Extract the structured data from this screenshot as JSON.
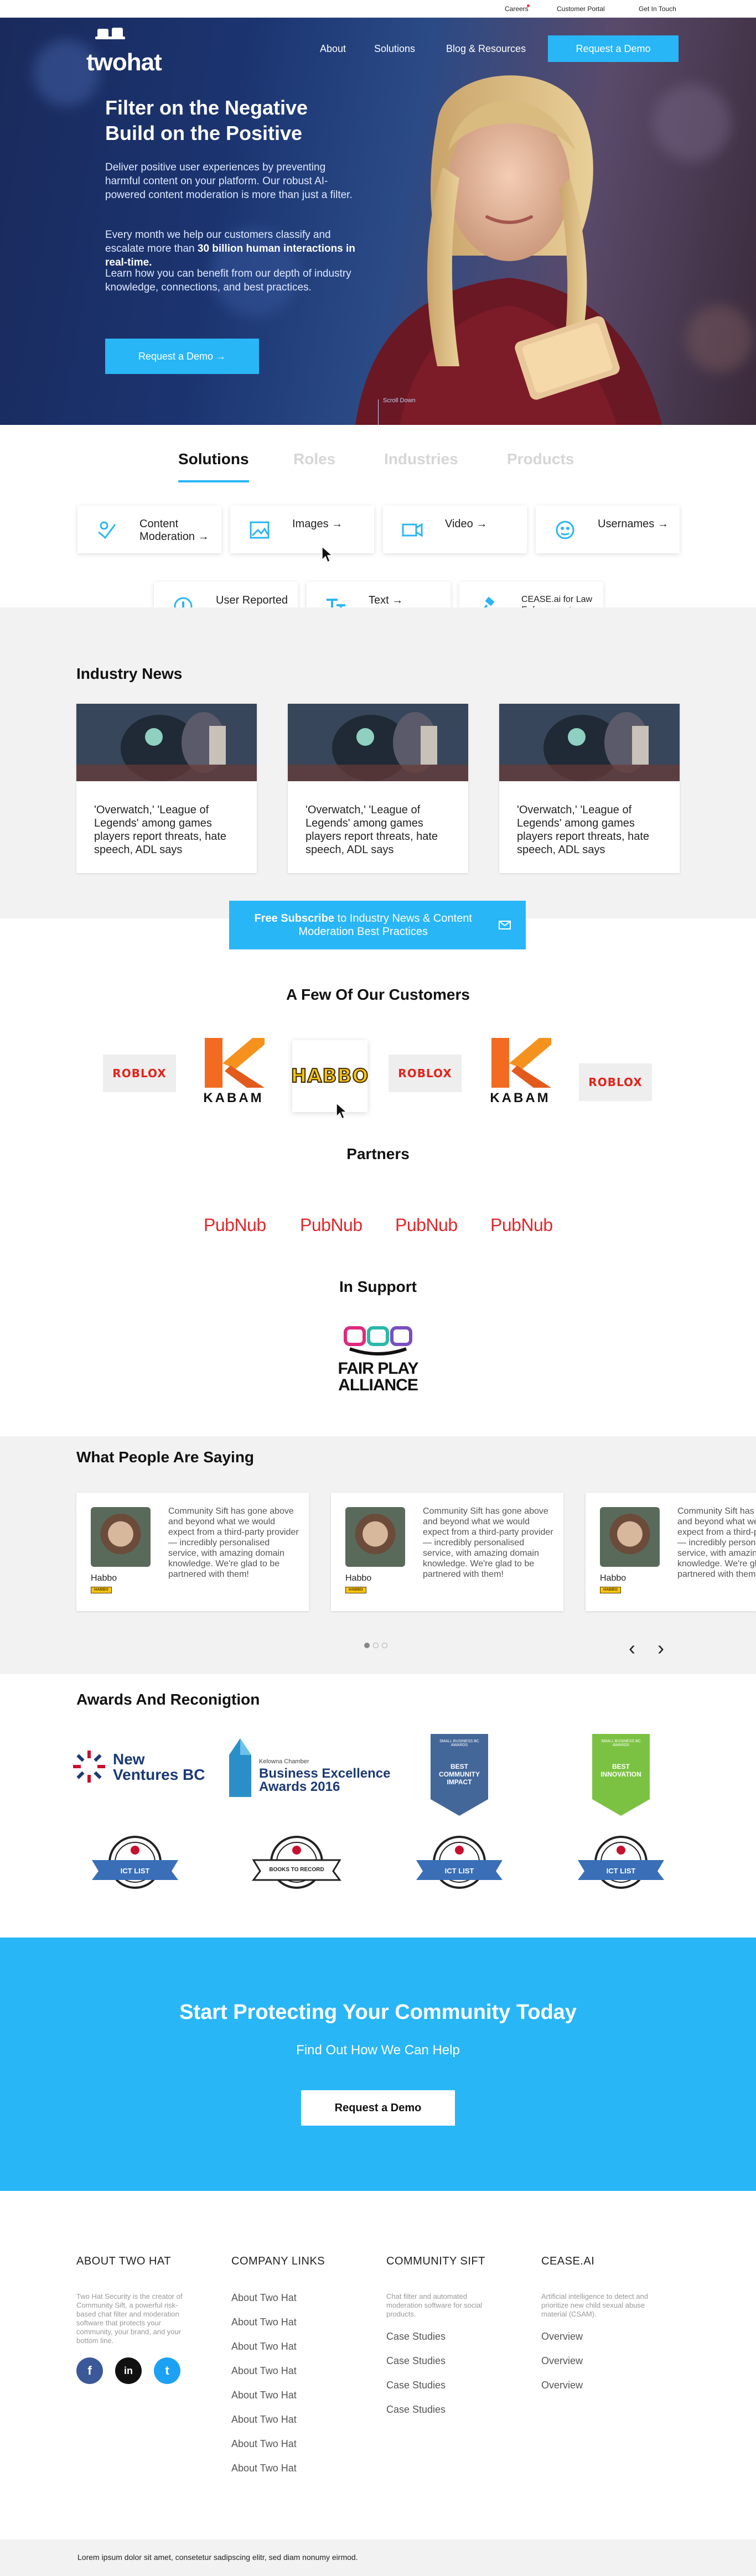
{
  "topbar": {
    "careers": "Careers",
    "customer_portal": "Customer Portal",
    "get_in_touch": "Get In Touch"
  },
  "brand": {
    "logo_text": "twohat"
  },
  "nav": {
    "about": "About",
    "solutions": "Solutions",
    "blog": "Blog & Resources",
    "request_demo": "Request a Demo"
  },
  "hero": {
    "title_line1": "Filter on the Negative",
    "title_line2": "Build on the Positive",
    "p1": "Deliver positive user experiences by preventing harmful content on your platform. Our robust AI-powered content moderation is more than just a filter.",
    "p2_pre": "Every month we help our customers classify and escalate more than ",
    "p2_bold": "30 billion human interactions in real-time.",
    "p3": "Learn how you can benefit from our depth of industry knowledge, connections, and best practices.",
    "cta": "Request a Demo →",
    "scroll_down": "Scroll Down"
  },
  "tabs": {
    "solutions": "Solutions",
    "roles": "Roles",
    "industries": "Industries",
    "products": "Products"
  },
  "solutions": [
    {
      "label": "Content Moderation →",
      "icon": "shield-check-icon"
    },
    {
      "label": "Images →",
      "icon": "image-icon"
    },
    {
      "label": "Video →",
      "icon": "video-icon"
    },
    {
      "label": "Usernames →",
      "icon": "user-mask-icon"
    },
    {
      "label": "User Reported Content →",
      "icon": "alert-circle-icon"
    },
    {
      "label": "Text →",
      "icon": "text-icon"
    },
    {
      "label": "CEASE.ai for Law Enforcement →",
      "icon": "gavel-icon"
    }
  ],
  "news": {
    "title": "Industry News",
    "items": [
      "'Overwatch,' 'League of Legends' among games players report threats, hate speech, ADL says",
      "'Overwatch,' 'League of Legends' among games players report threats, hate speech, ADL says",
      "'Overwatch,' 'League of Legends' among games players report threats, hate speech, ADL says"
    ],
    "subscribe_bold": "Free Subscribe",
    "subscribe_rest": " to Industry News & Content Moderation Best Practices"
  },
  "customers": {
    "title": "A Few Of Our Customers",
    "logos": [
      "ROBLOX",
      "KABAM",
      "HABBO",
      "ROBLOX",
      "KABAM",
      "ROBLOX"
    ]
  },
  "partners": {
    "title": "Partners",
    "logos": [
      "PubNub",
      "PubNub",
      "PubNub",
      "PubNub"
    ]
  },
  "support": {
    "title": "In Support",
    "logo_line1": "FAIR PLAY",
    "logo_line2": "ALLIANCE"
  },
  "testimonials": {
    "title": "What People Are Saying",
    "items": [
      {
        "quote": "Community Sift has gone above and beyond what we would expect from a third-party provider — incredibly personalised service, with amazing domain knowledge. We're glad to be partnered with them!",
        "name": "Habbo",
        "badge": "HABBO"
      },
      {
        "quote": "Community Sift has gone above and beyond what we would expect from a third-party provider — incredibly personalised service, with amazing domain knowledge. We're glad to be partnered with them!",
        "name": "Habbo",
        "badge": "HABBO"
      },
      {
        "quote": "Community Sift has gone above and beyond what we would expect from a third-party provider — incredibly personalised service, with amazing domain knowledge. We're glad to be partnered with them!",
        "name": "Habbo",
        "badge": "HABBO"
      }
    ],
    "prev": "‹",
    "next": "›"
  },
  "awards": {
    "title": "Awards And Reconigtion",
    "new_ventures_line1": "New",
    "new_ventures_line2": "Ventures BC",
    "kelowna_small": "Kelowna Chamber",
    "kelowna_line1": "Business Excellence",
    "kelowna_line2": "Awards 2016",
    "banner1_top": "SMALL BUSINESS BC AWARDS",
    "banner1_text": "BEST COMMUNITY IMPACT",
    "banner2_top": "SMALL BUSINESS BC AWARDS",
    "banner2_text": "BEST INNOVATION",
    "seals": [
      "ICT LIST",
      "BOOKS TO RECORD",
      "ICT LIST",
      "ICT LIST"
    ]
  },
  "cta": {
    "title": "Start Protecting Your Community Today",
    "subtitle": "Find Out How We Can Help",
    "button": "Request a Demo"
  },
  "footer": {
    "col1": {
      "title": "ABOUT TWO HAT",
      "desc": "Two Hat Security is the creator of Community Sift, a powerful risk-based chat filter and moderation software that protects your community, your brand, and your bottom line."
    },
    "col2": {
      "title": "COMPANY LINKS",
      "links": [
        "About Two Hat",
        "About Two Hat",
        "About Two Hat",
        "About Two Hat",
        "About Two Hat",
        "About Two Hat",
        "About Two Hat",
        "About Two Hat"
      ]
    },
    "col3": {
      "title": "COMMUNITY SIFT",
      "desc": "Chat filter and automated moderation software for social products.",
      "links": [
        "Case Studies",
        "Case Studies",
        "Case Studies",
        "Case Studies"
      ]
    },
    "col4": {
      "title": "CEASE.AI",
      "desc": "Artificial intelligence to detect and prioritize new child sexual abuse material (CSAM).",
      "links": [
        "Overview",
        "Overview",
        "Overview"
      ]
    },
    "social": {
      "facebook": "f",
      "instagram": "in",
      "twitter": "t"
    },
    "bottom": "Lorem ipsum dolor sit amet, consetetur sadipscing elitr, sed diam nonumy eirmod."
  },
  "colors": {
    "accent": "#29b6f6",
    "facebook": "#3b5998",
    "instagram": "#111111",
    "twitter": "#1da1f2",
    "pubnub": "#e3262a"
  }
}
